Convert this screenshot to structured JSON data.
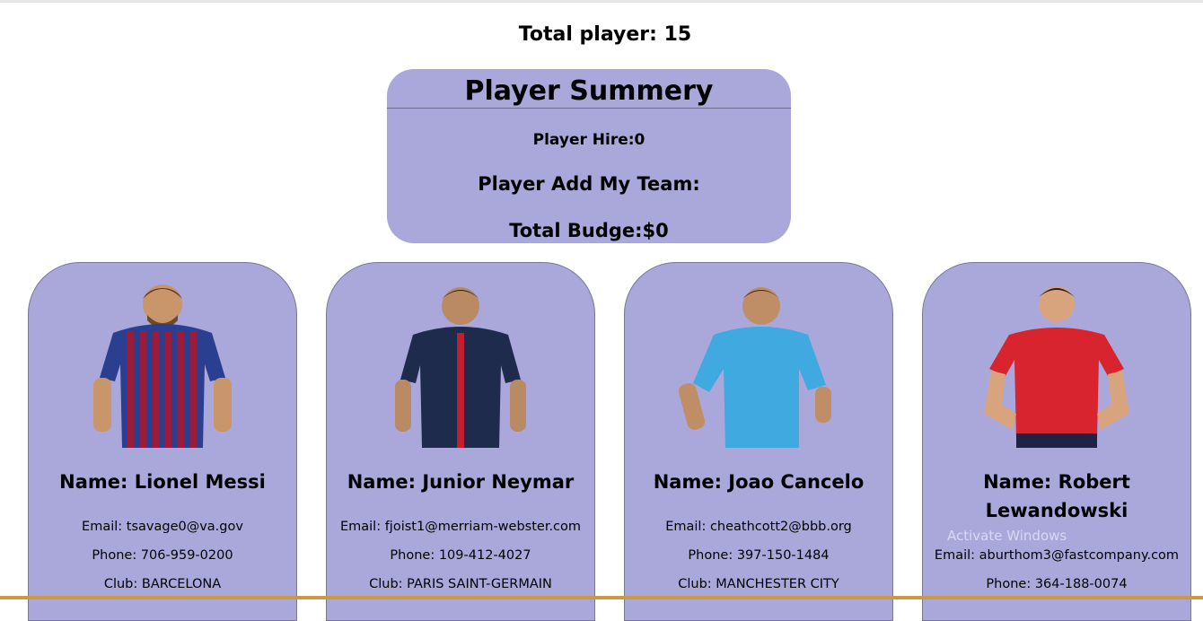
{
  "header": {
    "total_player": "Total player: 15"
  },
  "summary": {
    "title": "Player Summery",
    "hire": "Player Hire:0",
    "team": "Player Add My Team:",
    "budget": "Total Budge:$0"
  },
  "players": [
    {
      "name": "Name: Lionel Messi",
      "email": "Email: tsavage0@va.gov",
      "phone": "Phone: 706-959-0200",
      "club": "Club: BARCELONA",
      "shirt_color": "#2a3f8f",
      "stripe_color": "#9b1c3a"
    },
    {
      "name": "Name: Junior Neymar",
      "email": "Email: fjoist1@merriam-webster.com",
      "phone": "Phone: 109-412-4027",
      "club": "Club: PARIS SAINT-GERMAIN",
      "shirt_color": "#1f2b4d",
      "stripe_color": "#c21f32"
    },
    {
      "name": "Name: Joao Cancelo",
      "email": "Email: cheathcott2@bbb.org",
      "phone": "Phone: 397-150-1484",
      "club": "Club: MANCHESTER CITY",
      "shirt_color": "#3fa9e0",
      "stripe_color": "#3fa9e0"
    },
    {
      "name": "Name: Robert Lewandowski",
      "email": "Email: aburthom3@fastcompany.com",
      "phone": "Phone: 364-188-0074",
      "club": "",
      "shirt_color": "#d8242e",
      "stripe_color": "#d8242e"
    }
  ],
  "watermark": "Activate Windows"
}
